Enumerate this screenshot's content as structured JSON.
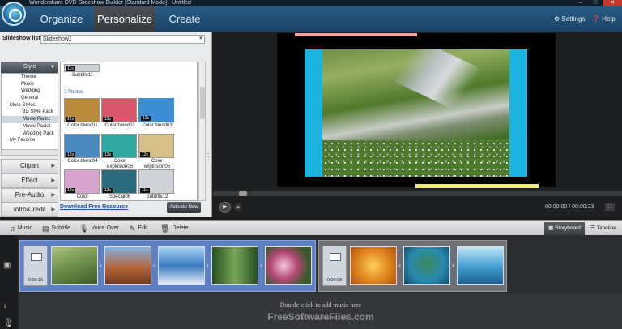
{
  "window": {
    "title": "Wondershare DVD Slideshow Builder [Standard Mode] - Untitled"
  },
  "menu": {
    "tabs": [
      {
        "label": "Organize"
      },
      {
        "label": "Personalize"
      },
      {
        "label": "Create"
      }
    ],
    "active_tab": "Personalize",
    "settings_label": "Settings",
    "help_label": "Help"
  },
  "slideshow": {
    "label": "Slideshow list :",
    "selected": "Slideshow1"
  },
  "categories": {
    "style_label": "Style",
    "tree": [
      {
        "label": "Theme",
        "level": 2
      },
      {
        "label": "Movie",
        "level": 2
      },
      {
        "label": "Wedding",
        "level": 2
      },
      {
        "label": "General",
        "level": 2
      },
      {
        "label": "More Styles",
        "level": 1
      },
      {
        "label": "3D Style Pack",
        "level": 3
      },
      {
        "label": "Movie Pack1",
        "level": 3,
        "selected": true
      },
      {
        "label": "Movie Pack2",
        "level": 3
      },
      {
        "label": "Wedding Pack",
        "level": 3
      },
      {
        "label": "My Favorite",
        "level": 1
      }
    ],
    "buttons": [
      {
        "label": "Clipart"
      },
      {
        "label": "Effect"
      },
      {
        "label": "Pre-Audio"
      },
      {
        "label": "Intro/Credit"
      }
    ]
  },
  "grid": {
    "group_label": "2 Photos",
    "top_item": {
      "label": "Subtitle11",
      "badge": "11s"
    },
    "items": [
      {
        "label": "Color blend01",
        "badge": "12s",
        "color": "#b98a3a"
      },
      {
        "label": "Color blend02",
        "badge": "12s",
        "color": "#d8576a"
      },
      {
        "label": "Color blend03",
        "badge": "12s",
        "color": "#3d8ed1",
        "selected": true
      },
      {
        "label": "Color blend04",
        "badge": "12s",
        "color": "#4a88c0"
      },
      {
        "label": "Color explosion05",
        "badge": "12s",
        "color": "#2fa9a0"
      },
      {
        "label": "Color explosion06",
        "badge": "12s",
        "color": "#d6c08a"
      },
      {
        "label": "Color",
        "badge": "12s",
        "color": "#d9a3d0"
      },
      {
        "label": "Special06",
        "badge": "12s",
        "color": "#2a6a7a"
      },
      {
        "label": "Subtitle12",
        "badge": "11s",
        "color": "#cfd3d8"
      }
    ],
    "download_link": "Download Free Resource",
    "activate_label": "Activate Now"
  },
  "player": {
    "time_current": "00:00:00",
    "time_total": "00:00:23",
    "time_separator": "/",
    "progress": 0.06
  },
  "editbar": {
    "music": "Music",
    "subtitle": "Subtitle",
    "voiceover": "Voice Over",
    "edit": "Edit",
    "delete": "Delete",
    "storyboard": "Storyboard",
    "timeline": "Timeline"
  },
  "storyboard": {
    "group1": {
      "duration": "0:00:15",
      "slides": [
        "#6b8f4a",
        "#b8643a",
        "#3b7ac2",
        "#3e7a3a",
        "#b64878"
      ]
    },
    "group2": {
      "duration": "0:00:08",
      "slides": [
        "#e08a20",
        "#2a8ab0",
        "#3f9bd0"
      ]
    },
    "music_hint": "Double-click to add music here",
    "record_hint": "Double-click to record"
  },
  "watermark": "FreeSoftwareFiles.com",
  "colors": {
    "accent": "#1b4467",
    "cyan": "#1bb4e0",
    "pink": "#f5a3a3",
    "yellow": "#f3ec6a"
  }
}
